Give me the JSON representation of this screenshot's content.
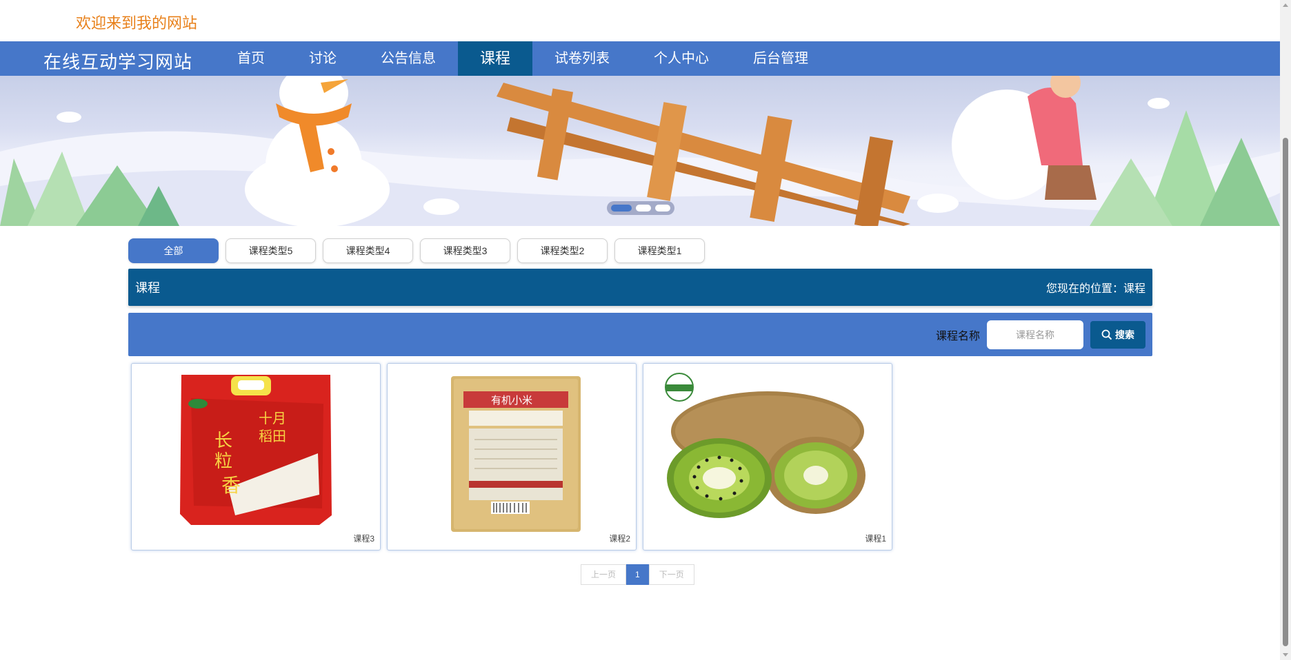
{
  "header": {
    "welcome_text": "欢迎来到我的网站"
  },
  "nav": {
    "site_title": "在线互动学习网站",
    "items": [
      {
        "label": "首页"
      },
      {
        "label": "讨论"
      },
      {
        "label": "公告信息"
      },
      {
        "label": "课程",
        "active": true
      },
      {
        "label": "试卷列表"
      },
      {
        "label": "个人中心"
      },
      {
        "label": "后台管理"
      }
    ]
  },
  "banner": {
    "slide_count": 3,
    "active_slide": 1
  },
  "categories": {
    "items": [
      {
        "label": "全部",
        "active": true
      },
      {
        "label": "课程类型5"
      },
      {
        "label": "课程类型4"
      },
      {
        "label": "课程类型3"
      },
      {
        "label": "课程类型2"
      },
      {
        "label": "课程类型1"
      }
    ]
  },
  "section": {
    "title": "课程",
    "breadcrumb": "您现在的位置：课程"
  },
  "search": {
    "label": "课程名称",
    "placeholder": "课程名称",
    "button_label": "搜索"
  },
  "courses": [
    {
      "name": "课程3",
      "image": "rice-bag"
    },
    {
      "name": "课程2",
      "image": "millet-package"
    },
    {
      "name": "课程1",
      "image": "kiwi-fruit"
    }
  ],
  "pagination": {
    "prev_label": "上一页",
    "current_page": "1",
    "next_label": "下一页"
  },
  "colors": {
    "nav_bg": "#4677c9",
    "nav_active": "#0a5a8f",
    "welcome_text": "#e8801a",
    "title_bar": "#0a5a8f"
  }
}
